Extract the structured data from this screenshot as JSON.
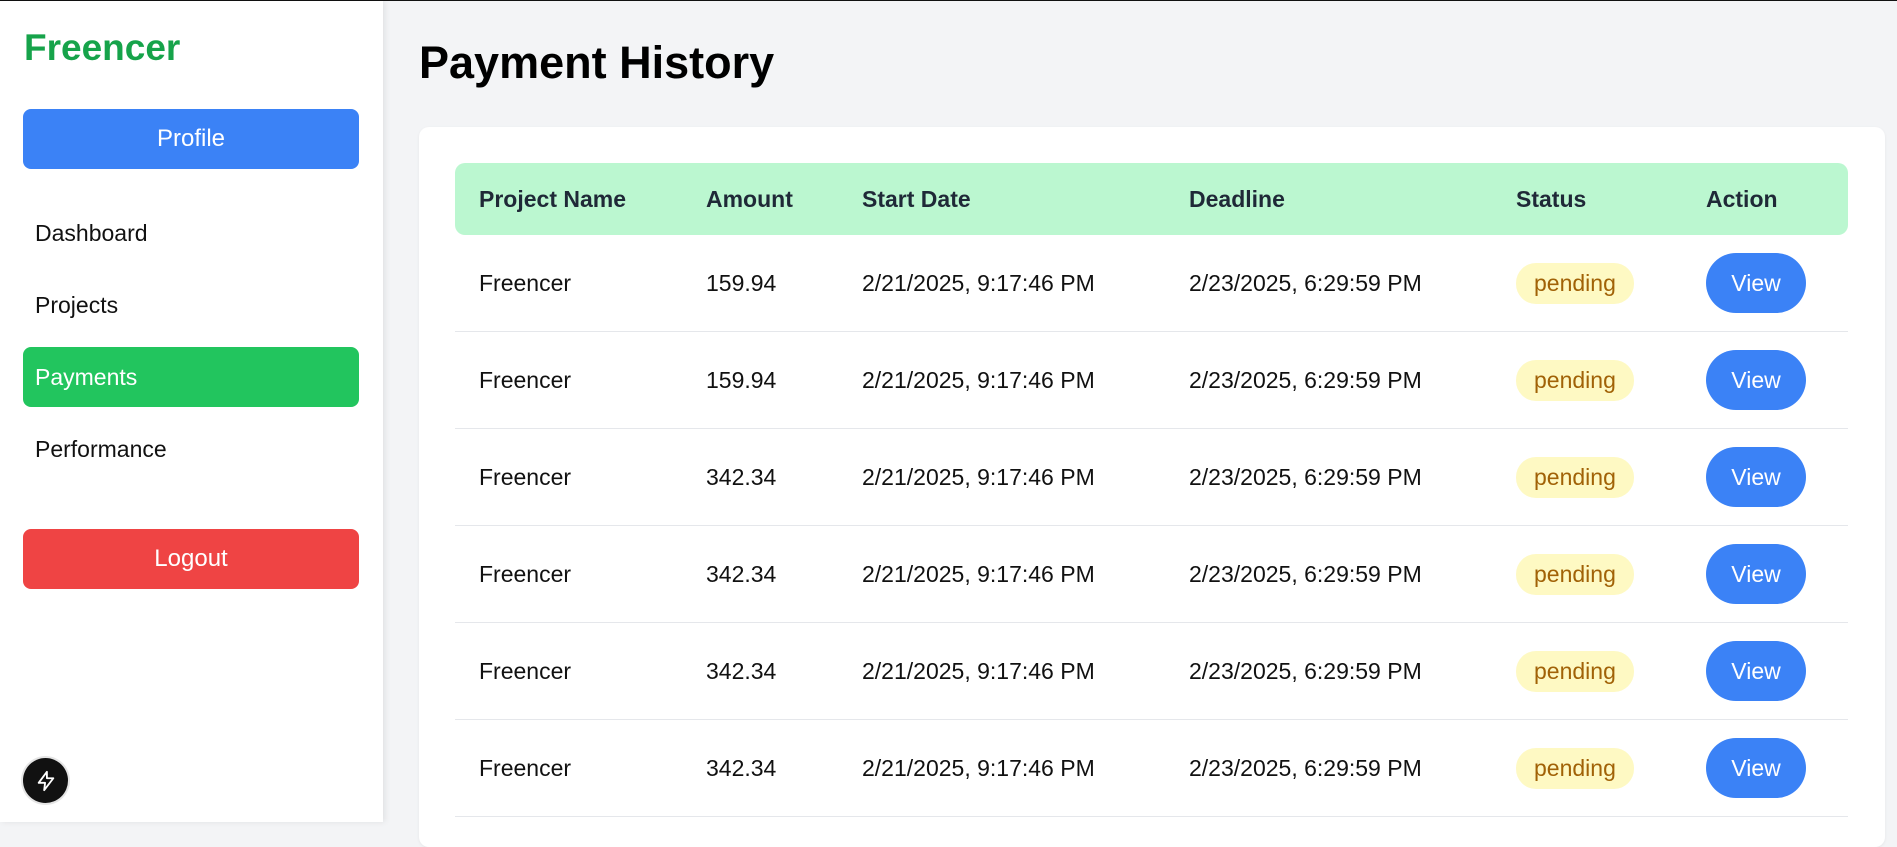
{
  "sidebar": {
    "brand": "Freencer",
    "profile_label": "Profile",
    "nav": [
      {
        "label": "Dashboard",
        "active": false
      },
      {
        "label": "Projects",
        "active": false
      },
      {
        "label": "Payments",
        "active": true
      },
      {
        "label": "Performance",
        "active": false
      }
    ],
    "logout_label": "Logout"
  },
  "main": {
    "title": "Payment History",
    "table": {
      "headers": [
        "Project Name",
        "Amount",
        "Start Date",
        "Deadline",
        "Status",
        "Action"
      ],
      "rows": [
        {
          "project": "Freencer",
          "amount": "159.94",
          "start": "2/21/2025, 9:17:46 PM",
          "deadline": "2/23/2025, 6:29:59 PM",
          "status": "pending",
          "action": "View"
        },
        {
          "project": "Freencer",
          "amount": "159.94",
          "start": "2/21/2025, 9:17:46 PM",
          "deadline": "2/23/2025, 6:29:59 PM",
          "status": "pending",
          "action": "View"
        },
        {
          "project": "Freencer",
          "amount": "342.34",
          "start": "2/21/2025, 9:17:46 PM",
          "deadline": "2/23/2025, 6:29:59 PM",
          "status": "pending",
          "action": "View"
        },
        {
          "project": "Freencer",
          "amount": "342.34",
          "start": "2/21/2025, 9:17:46 PM",
          "deadline": "2/23/2025, 6:29:59 PM",
          "status": "pending",
          "action": "View"
        },
        {
          "project": "Freencer",
          "amount": "342.34",
          "start": "2/21/2025, 9:17:46 PM",
          "deadline": "2/23/2025, 6:29:59 PM",
          "status": "pending",
          "action": "View"
        },
        {
          "project": "Freencer",
          "amount": "342.34",
          "start": "2/21/2025, 9:17:46 PM",
          "deadline": "2/23/2025, 6:29:59 PM",
          "status": "pending",
          "action": "View"
        }
      ]
    }
  },
  "colors": {
    "brand": "#16a34a",
    "primary": "#3b82f6",
    "active_nav": "#22c55e",
    "danger": "#ef4444",
    "table_header": "#bbf7d0",
    "badge_bg": "#fef9c3",
    "badge_text": "#a16207"
  },
  "icons": {
    "fab": "lightning-bolt-icon"
  }
}
